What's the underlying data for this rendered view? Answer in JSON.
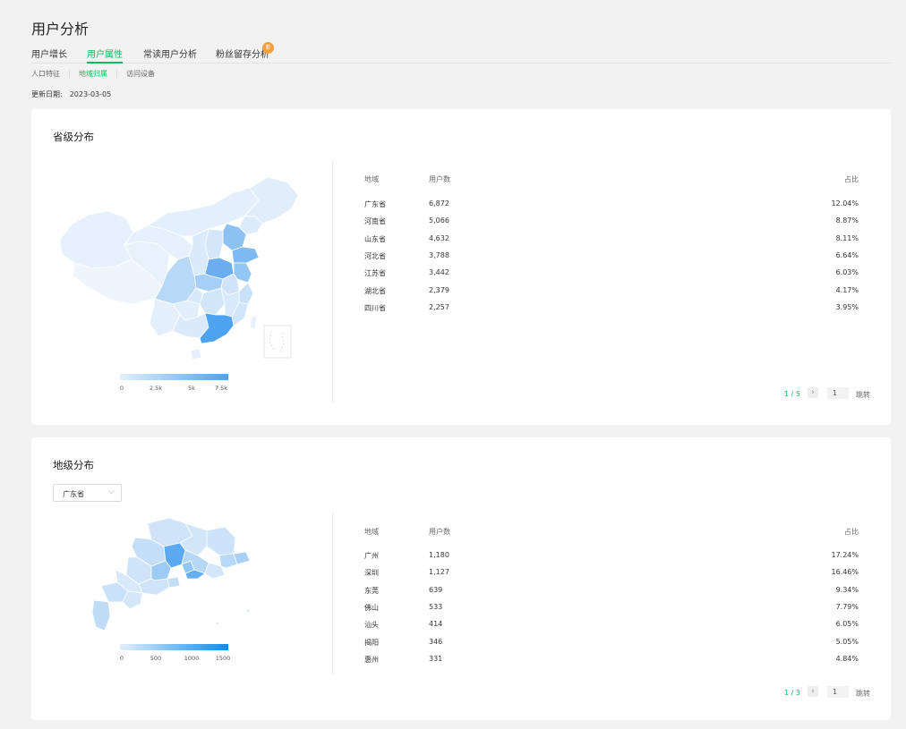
{
  "page": {
    "title": "用户分析"
  },
  "tabs": [
    {
      "label": "用户增长"
    },
    {
      "label": "用户属性"
    },
    {
      "label": "常读用户分析"
    },
    {
      "label": "粉丝留存分析",
      "badge": "新"
    }
  ],
  "subtabs": [
    {
      "label": "人口特征"
    },
    {
      "label": "地域归属"
    },
    {
      "label": "访问设备"
    }
  ],
  "update": {
    "label": "更新日期:",
    "date": "2023-03-05"
  },
  "colors": {
    "accent": "#07c160",
    "badge": "#fa9d3b",
    "map_light": "#e3effc",
    "map_dark": "#4da3f0",
    "map2_dark": "#0a8cf2"
  },
  "province": {
    "title": "省级分布",
    "headers": {
      "region": "地域",
      "users": "用户数",
      "ratio": "占比"
    },
    "rows": [
      {
        "region": "广东省",
        "users": "6,872",
        "ratio": "12.04%"
      },
      {
        "region": "河南省",
        "users": "5,066",
        "ratio": "8.87%"
      },
      {
        "region": "山东省",
        "users": "4,632",
        "ratio": "8.11%"
      },
      {
        "region": "河北省",
        "users": "3,788",
        "ratio": "6.64%"
      },
      {
        "region": "江苏省",
        "users": "3,442",
        "ratio": "6.03%"
      },
      {
        "region": "湖北省",
        "users": "2,379",
        "ratio": "4.17%"
      },
      {
        "region": "四川省",
        "users": "2,257",
        "ratio": "3.95%"
      }
    ],
    "legend": [
      "0",
      "2.5k",
      "5k",
      "7.5k"
    ],
    "pager": {
      "page": "1 / 5",
      "input": "1",
      "jump": "跳转",
      "arrow": "›"
    }
  },
  "city": {
    "title": "地级分布",
    "select": "广东省",
    "select_icon": "chevron-down-icon",
    "headers": {
      "region": "地域",
      "users": "用户数",
      "ratio": "占比"
    },
    "rows": [
      {
        "region": "广州",
        "users": "1,180",
        "ratio": "17.24%"
      },
      {
        "region": "深圳",
        "users": "1,127",
        "ratio": "16.46%"
      },
      {
        "region": "东莞",
        "users": "639",
        "ratio": "9.34%"
      },
      {
        "region": "佛山",
        "users": "533",
        "ratio": "7.79%"
      },
      {
        "region": "汕头",
        "users": "414",
        "ratio": "6.05%"
      },
      {
        "region": "揭阳",
        "users": "346",
        "ratio": "5.05%"
      },
      {
        "region": "惠州",
        "users": "331",
        "ratio": "4.84%"
      }
    ],
    "legend": [
      "0",
      "500",
      "1000",
      "1500"
    ],
    "pager": {
      "page": "1 / 3",
      "input": "1",
      "jump": "跳转",
      "arrow": "›"
    }
  }
}
